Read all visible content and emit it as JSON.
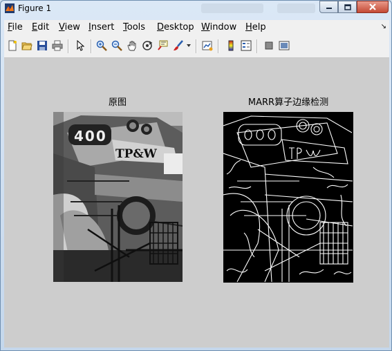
{
  "window": {
    "title": "Figure 1"
  },
  "menu": [
    "File",
    "Edit",
    "View",
    "Insert",
    "Tools",
    "Desktop",
    "Window",
    "Help"
  ],
  "menu_mnemonics": [
    "F",
    "E",
    "V",
    "I",
    "T",
    "D",
    "W",
    "H"
  ],
  "toolbar": [
    "new-figure-icon",
    "open-file-icon",
    "save-icon",
    "print-icon",
    "edit-plot-arrow-icon",
    "zoom-in-icon",
    "zoom-out-icon",
    "pan-hand-icon",
    "rotate-3d-icon",
    "data-cursor-icon",
    "brush-icon",
    "brush-dropdown-icon",
    "link-plot-icon",
    "insert-colorbar-icon",
    "insert-legend-icon",
    "hide-plot-tools-icon",
    "show-plot-tools-icon"
  ],
  "axes": [
    {
      "title": "原图"
    },
    {
      "title": "MARR算子边缘检测"
    }
  ],
  "images": [
    {
      "text": "400"
    },
    {
      "text": "TP&W"
    }
  ],
  "colors": {
    "figure_bg": "#cdcdcd",
    "menu_bg": "#f0f0f0"
  }
}
